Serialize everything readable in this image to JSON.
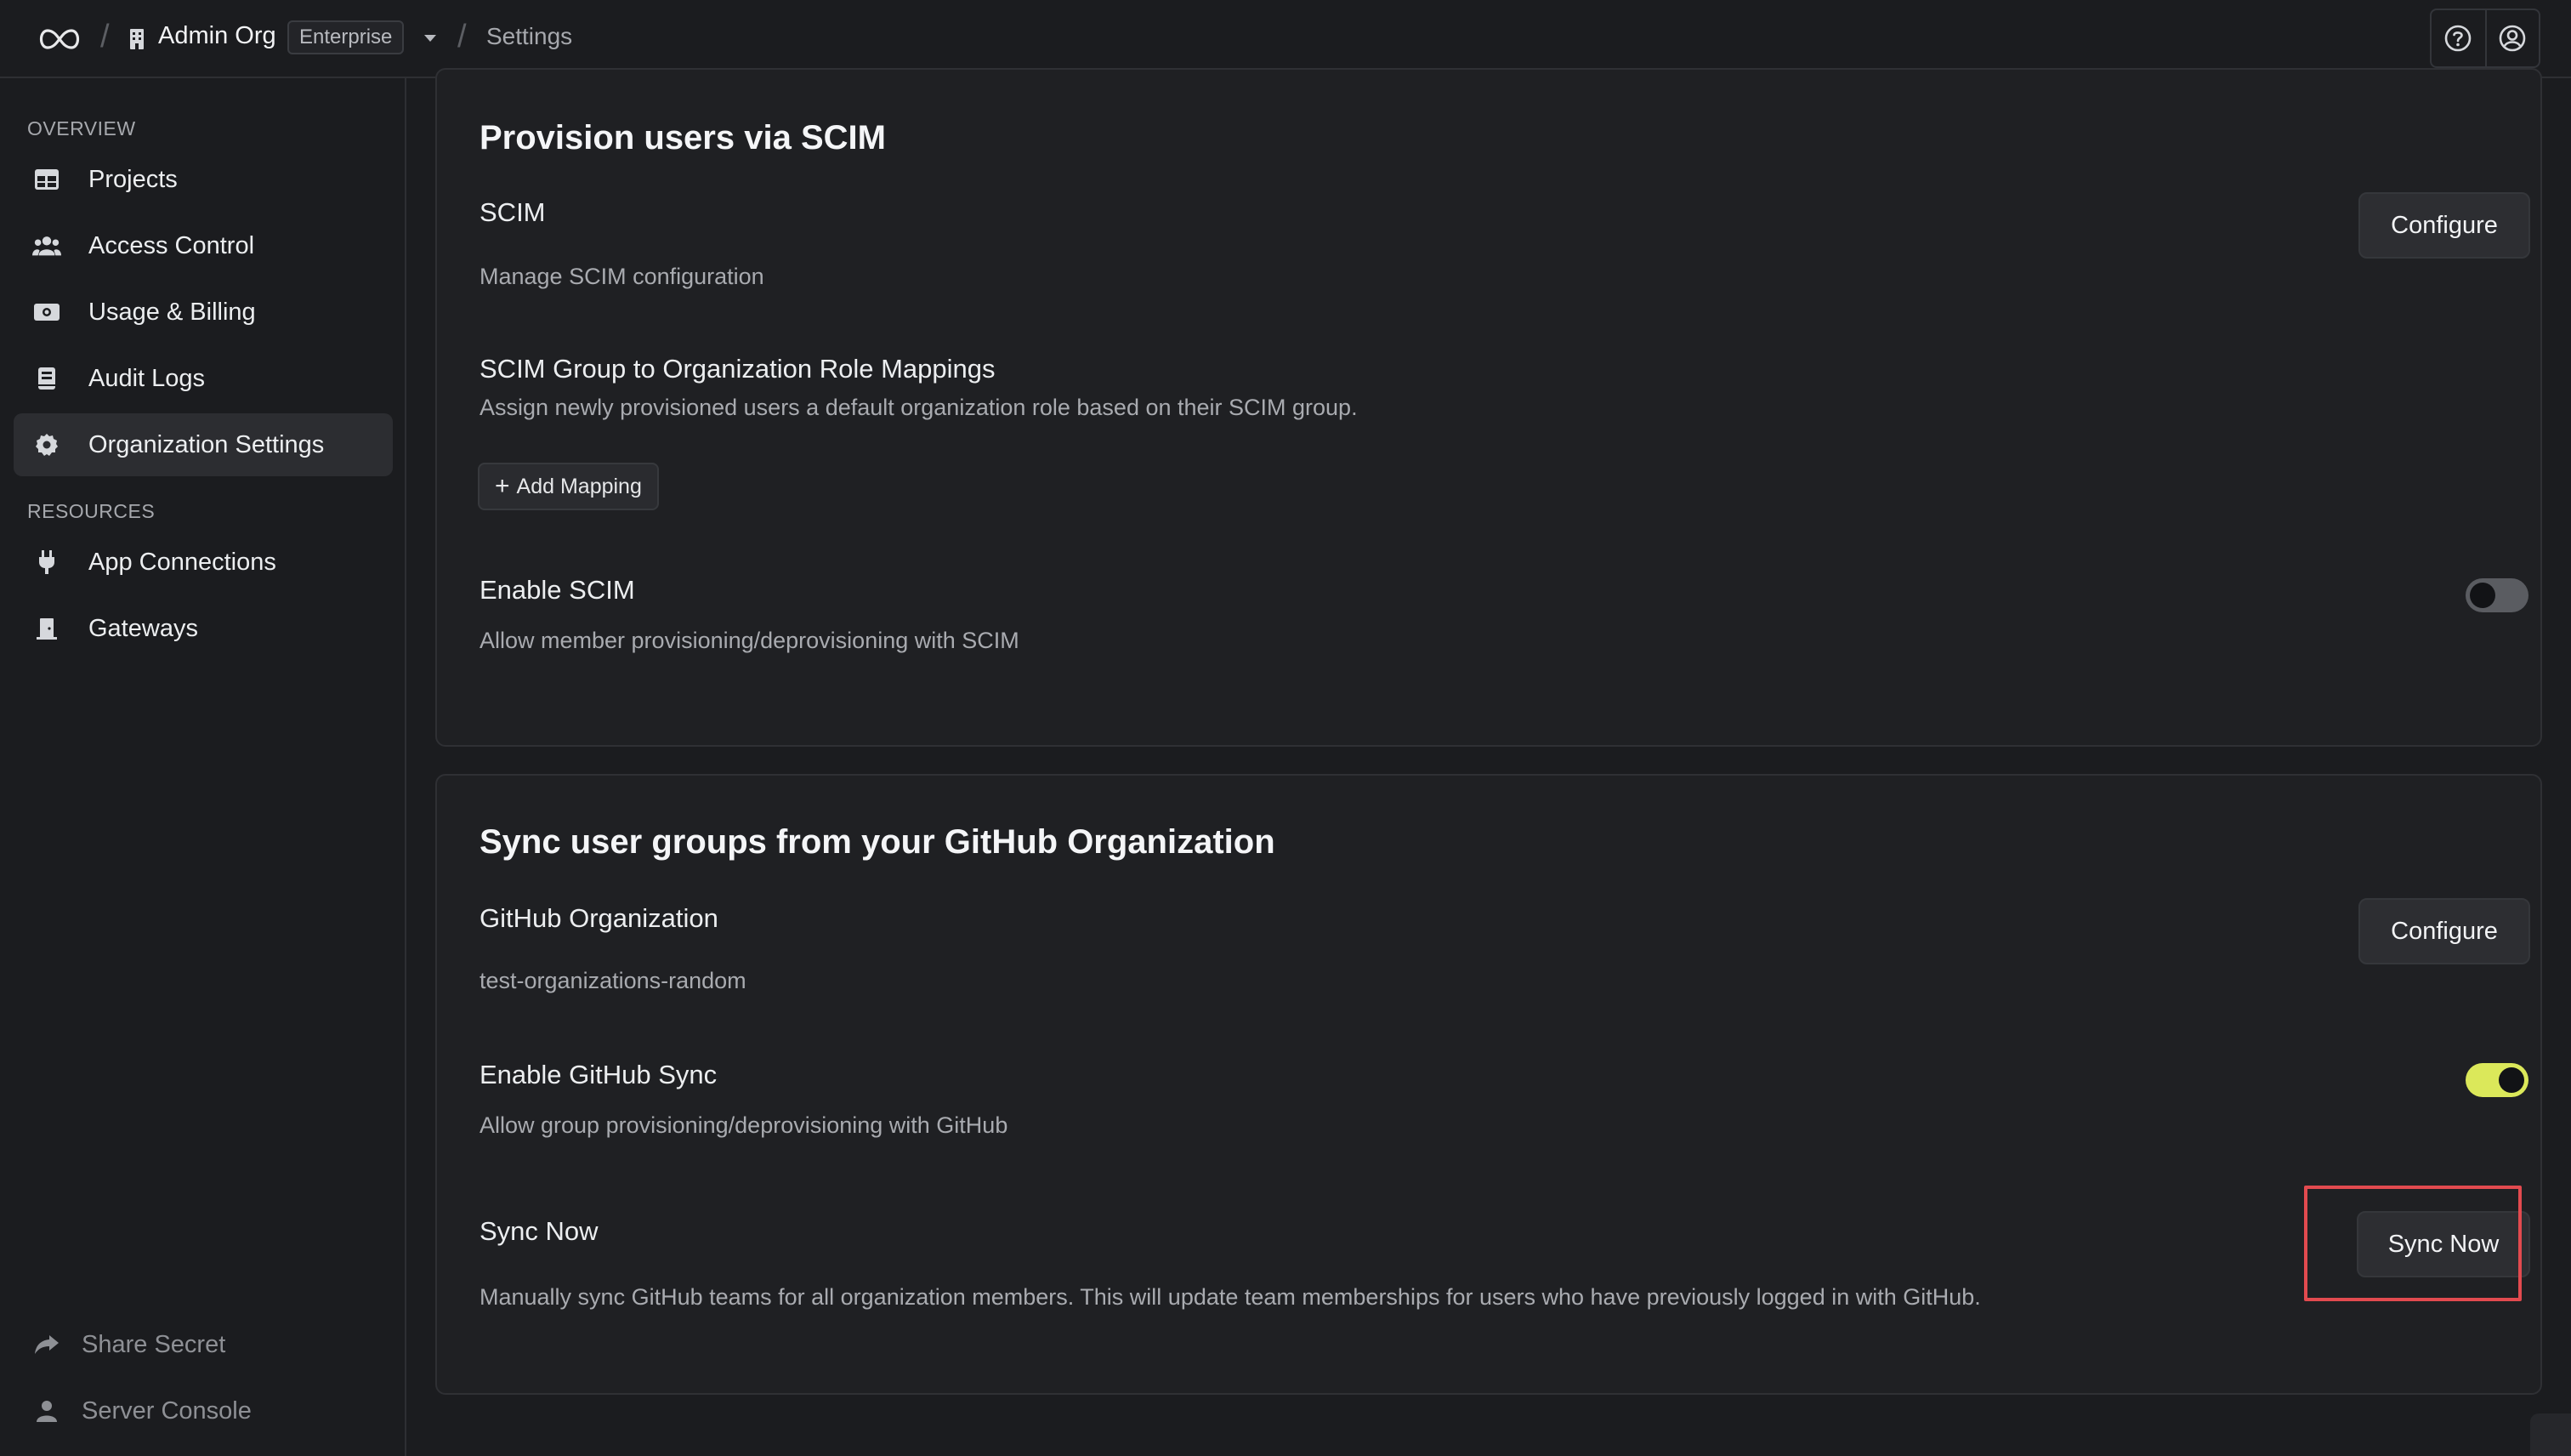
{
  "header": {
    "org_name": "Admin Org",
    "plan_badge": "Enterprise",
    "breadcrumb": "Settings"
  },
  "sidebar": {
    "overview_label": "OVERVIEW",
    "resources_label": "RESOURCES",
    "items": [
      {
        "label": "Projects",
        "icon": "table-icon"
      },
      {
        "label": "Access Control",
        "icon": "users-icon"
      },
      {
        "label": "Usage & Billing",
        "icon": "money-icon"
      },
      {
        "label": "Audit Logs",
        "icon": "book-icon"
      },
      {
        "label": "Organization Settings",
        "icon": "gear-icon",
        "active": true
      }
    ],
    "resource_items": [
      {
        "label": "App Connections",
        "icon": "plug-icon"
      },
      {
        "label": "Gateways",
        "icon": "door-icon"
      }
    ],
    "footer_items": [
      {
        "label": "Share Secret",
        "icon": "share-icon"
      },
      {
        "label": "Server Console",
        "icon": "user-icon"
      }
    ]
  },
  "scim": {
    "title": "Provision users via SCIM",
    "scim_label": "SCIM",
    "scim_desc": "Manage SCIM configuration",
    "configure_label": "Configure",
    "mapping_title": "SCIM Group to Organization Role Mappings",
    "mapping_desc": "Assign newly provisioned users a default organization role based on their SCIM group.",
    "add_mapping_label": "Add Mapping",
    "enable_title": "Enable SCIM",
    "enable_desc": "Allow member provisioning/deprovisioning with SCIM",
    "enabled": false
  },
  "github": {
    "title": "Sync user groups from your GitHub Organization",
    "org_label": "GitHub Organization",
    "org_value": "test-organizations-random",
    "configure_label": "Configure",
    "enable_title": "Enable GitHub Sync",
    "enable_desc": "Allow group provisioning/deprovisioning with GitHub",
    "enabled": true,
    "sync_title": "Sync Now",
    "sync_desc": "Manually sync GitHub teams for all organization members. This will update team memberships for users who have previously logged in with GitHub.",
    "sync_button_label": "Sync Now"
  },
  "colors": {
    "accent_toggle": "#dbe85a",
    "highlight": "#e24a4f",
    "background": "#1b1c1f"
  }
}
